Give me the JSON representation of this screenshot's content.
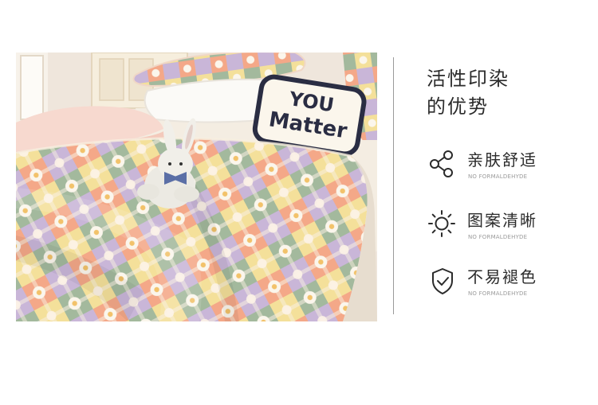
{
  "product_photo": {
    "pillow_text_line1": "YOU",
    "pillow_text_line2": "Matter"
  },
  "heading": {
    "line1": "活性印染",
    "line2": "的优势"
  },
  "features": [
    {
      "icon": "share-nodes-icon",
      "title": "亲肤舒适",
      "subtitle": "NO FORMALDEHYDE"
    },
    {
      "icon": "sun-icon",
      "title": "图案清晰",
      "subtitle": "NO FORMALDEHYDE"
    },
    {
      "icon": "shield-check-icon",
      "title": "不易褪色",
      "subtitle": "NO FORMALDEHYDE"
    }
  ],
  "colors": {
    "text": "#2b2b2b",
    "subtext": "#9b9b9b",
    "divider": "#9a9a9a",
    "quilt_peach": "#f3a582",
    "quilt_lavender": "#c7b3d6",
    "quilt_green": "#9fb79a",
    "quilt_yellow": "#f3df97",
    "quilt_cream": "#f7efe0"
  }
}
